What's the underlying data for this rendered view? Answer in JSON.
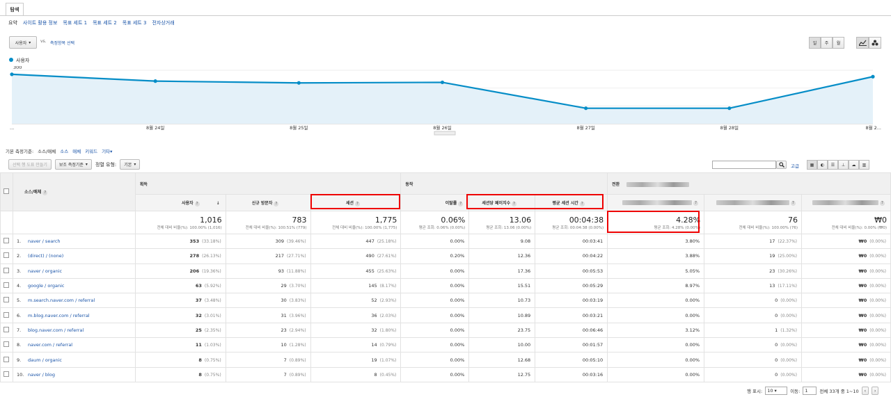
{
  "tab": "탐색",
  "subnav": [
    "요약",
    "사이트 활용 정보",
    "목표 세트 1",
    "목표 세트 2",
    "목표 세트 3",
    "전자상거래"
  ],
  "metric_selector": "사용자",
  "vs": "vs.",
  "compare_link": "측정항목 선택",
  "periods": [
    "일",
    "주",
    "월"
  ],
  "legend": "사용자",
  "chart_data": {
    "type": "area",
    "series": [
      {
        "name": "사용자",
        "values": [
          277,
          239,
          229,
          232,
          87,
          87,
          264
        ]
      }
    ],
    "x_labels": [
      "...",
      "8월 24일",
      "8월 25일",
      "8월 26일",
      "8월 27일",
      "8월 28일",
      "8월 2..."
    ],
    "yticks": [
      "300",
      "200",
      "100"
    ],
    "ylim": [
      0,
      300
    ],
    "color": "#058dc7",
    "fill": "#e4f1f9"
  },
  "dims": {
    "label": "기본 측정기준:",
    "active": "소스/매체",
    "items": [
      "소스",
      "매체",
      "키워드",
      "기타"
    ]
  },
  "toolbar": {
    "chart_btn": "선택 행 도표 만들기",
    "secondary_btn": "보조 측정기준",
    "sort_label": "정렬 유형:",
    "sort_btn": "기본",
    "advanced": "고급"
  },
  "table": {
    "groups": {
      "acquisition": "획득",
      "behavior": "동작",
      "conversion": "전환"
    },
    "source_header": "소스/매체",
    "headers": [
      "사용자",
      "신규 방문자",
      "세션",
      "이탈률",
      "세션당 페이지수",
      "평균 세션 시간"
    ],
    "totals": [
      {
        "value": "1,016",
        "sub": "전체 대비 비율(%): 100.00% (1,016)"
      },
      {
        "value": "783",
        "sub": "전체 대비 비율(%): 100.51% (779)"
      },
      {
        "value": "1,775",
        "sub": "전체 대비 비율(%): 100.00% (1,775)"
      },
      {
        "value": "0.06%",
        "sub": "평균 조회: 0.06% (0.00%)"
      },
      {
        "value": "13.06",
        "sub": "평균 조회: 13.06 (0.00%)"
      },
      {
        "value": "00:04:38",
        "sub": "평균 조회: 00:04:38 (0.00%)"
      },
      {
        "value": "4.28%",
        "sub": "평균 조회: 4.28% (0.00%)"
      },
      {
        "value": "76",
        "sub": "전체 대비 비율(%): 100.00% (76)"
      },
      {
        "value": "₩0",
        "sub": "전체 대비 비율(%): 0.00% (₩0)"
      }
    ],
    "rows": [
      {
        "idx": "1.",
        "source": "naver / search",
        "users": "353",
        "users_pct": "(33.18%)",
        "new": "309",
        "new_pct": "(39.46%)",
        "sessions": "447",
        "sessions_pct": "(25.18%)",
        "bounce": "0.00%",
        "pps": "9.08",
        "dur": "00:03:41",
        "conv": "3.80%",
        "goal": "17",
        "goal_pct": "(22.37%)",
        "rev": "₩0",
        "rev_pct": "(0.00%)"
      },
      {
        "idx": "2.",
        "source": "(direct) / (none)",
        "users": "278",
        "users_pct": "(26.13%)",
        "new": "217",
        "new_pct": "(27.71%)",
        "sessions": "490",
        "sessions_pct": "(27.61%)",
        "bounce": "0.20%",
        "pps": "12.36",
        "dur": "00:04:22",
        "conv": "3.88%",
        "goal": "19",
        "goal_pct": "(25.00%)",
        "rev": "₩0",
        "rev_pct": "(0.00%)"
      },
      {
        "idx": "3.",
        "source": "naver / organic",
        "users": "206",
        "users_pct": "(19.36%)",
        "new": "93",
        "new_pct": "(11.88%)",
        "sessions": "455",
        "sessions_pct": "(25.63%)",
        "bounce": "0.00%",
        "pps": "17.36",
        "dur": "00:05:53",
        "conv": "5.05%",
        "goal": "23",
        "goal_pct": "(30.26%)",
        "rev": "₩0",
        "rev_pct": "(0.00%)"
      },
      {
        "idx": "4.",
        "source": "google / organic",
        "users": "63",
        "users_pct": "(5.92%)",
        "new": "29",
        "new_pct": "(3.70%)",
        "sessions": "145",
        "sessions_pct": "(8.17%)",
        "bounce": "0.00%",
        "pps": "15.51",
        "dur": "00:05:29",
        "conv": "8.97%",
        "goal": "13",
        "goal_pct": "(17.11%)",
        "rev": "₩0",
        "rev_pct": "(0.00%)"
      },
      {
        "idx": "5.",
        "source": "m.search.naver.com / referral",
        "users": "37",
        "users_pct": "(3.48%)",
        "new": "30",
        "new_pct": "(3.83%)",
        "sessions": "52",
        "sessions_pct": "(2.93%)",
        "bounce": "0.00%",
        "pps": "10.73",
        "dur": "00:03:19",
        "conv": "0.00%",
        "goal": "0",
        "goal_pct": "(0.00%)",
        "rev": "₩0",
        "rev_pct": "(0.00%)"
      },
      {
        "idx": "6.",
        "source": "m.blog.naver.com / referral",
        "users": "32",
        "users_pct": "(3.01%)",
        "new": "31",
        "new_pct": "(3.96%)",
        "sessions": "36",
        "sessions_pct": "(2.03%)",
        "bounce": "0.00%",
        "pps": "10.89",
        "dur": "00:03:21",
        "conv": "0.00%",
        "goal": "0",
        "goal_pct": "(0.00%)",
        "rev": "₩0",
        "rev_pct": "(0.00%)"
      },
      {
        "idx": "7.",
        "source": "blog.naver.com / referral",
        "users": "25",
        "users_pct": "(2.35%)",
        "new": "23",
        "new_pct": "(2.94%)",
        "sessions": "32",
        "sessions_pct": "(1.80%)",
        "bounce": "0.00%",
        "pps": "23.75",
        "dur": "00:06:46",
        "conv": "3.12%",
        "goal": "1",
        "goal_pct": "(1.32%)",
        "rev": "₩0",
        "rev_pct": "(0.00%)"
      },
      {
        "idx": "8.",
        "source": "naver.com / referral",
        "users": "11",
        "users_pct": "(1.03%)",
        "new": "10",
        "new_pct": "(1.28%)",
        "sessions": "14",
        "sessions_pct": "(0.79%)",
        "bounce": "0.00%",
        "pps": "10.00",
        "dur": "00:01:57",
        "conv": "0.00%",
        "goal": "0",
        "goal_pct": "(0.00%)",
        "rev": "₩0",
        "rev_pct": "(0.00%)"
      },
      {
        "idx": "9.",
        "source": "daum / organic",
        "users": "8",
        "users_pct": "(0.75%)",
        "new": "7",
        "new_pct": "(0.89%)",
        "sessions": "19",
        "sessions_pct": "(1.07%)",
        "bounce": "0.00%",
        "pps": "12.68",
        "dur": "00:05:10",
        "conv": "0.00%",
        "goal": "0",
        "goal_pct": "(0.00%)",
        "rev": "₩0",
        "rev_pct": "(0.00%)"
      },
      {
        "idx": "10.",
        "source": "naver / blog",
        "users": "8",
        "users_pct": "(0.75%)",
        "new": "7",
        "new_pct": "(0.89%)",
        "sessions": "8",
        "sessions_pct": "(0.45%)",
        "bounce": "0.00%",
        "pps": "12.75",
        "dur": "00:03:16",
        "conv": "0.00%",
        "goal": "0",
        "goal_pct": "(0.00%)",
        "rev": "₩0",
        "rev_pct": "(0.00%)"
      }
    ]
  },
  "pager": {
    "rows_label": "행 표시:",
    "rows_value": "10",
    "goto_label": "이동:",
    "goto_value": "1",
    "range": "전체 33개 중 1~10"
  }
}
